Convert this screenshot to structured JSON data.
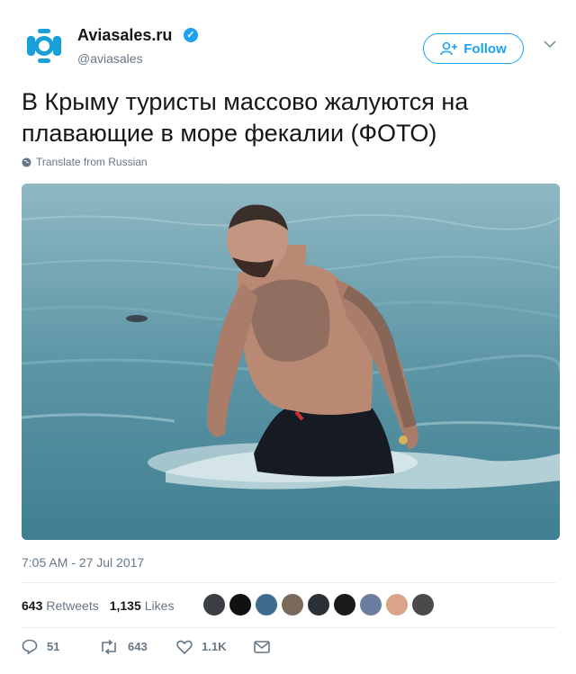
{
  "author": {
    "name": "Aviasales.ru",
    "handle": "@aviasales"
  },
  "follow_label": "Follow",
  "tweet_text": "В Крыму туристы массово жалуются на плавающие в море фекалии (ФОТО)",
  "translate_label": "Translate from Russian",
  "timestamp": "7:05 AM - 27 Jul 2017",
  "stats": {
    "retweets_count": "643",
    "retweets_label": "Retweets",
    "likes_count": "1,135",
    "likes_label": "Likes"
  },
  "likers": [
    "#3b3e44",
    "#111111",
    "#3f6b8c",
    "#7a6a5e",
    "#2b2f36",
    "#1a1a1a",
    "#6b7ea0",
    "#d9a48a",
    "#4a4a4a"
  ],
  "actions": {
    "replies": "51",
    "retweets": "643",
    "likes": "1.1K"
  },
  "colors": {
    "brand": "#1da1f2",
    "muted": "#657786",
    "text": "#14171a"
  },
  "icons": [
    "aviasales-logo-icon",
    "verified-icon",
    "follow-user-icon",
    "chevron-down-icon",
    "globe-icon",
    "reply-icon",
    "retweet-icon",
    "like-icon",
    "message-icon"
  ]
}
